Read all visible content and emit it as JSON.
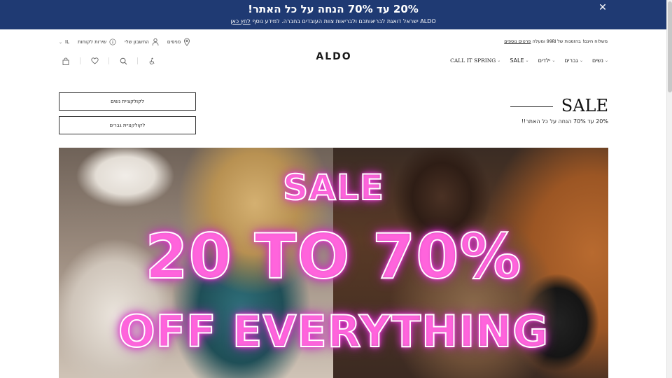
{
  "promo": {
    "title": "20% עד 70% הנחה על כל האתר!",
    "subtitle": "ALDO ישראל דואגת לבריאותכם ולבריאות צוות העובדים בחברה. למידע נוסף",
    "link_label": "לחץ כאן",
    "close_icon": "close-icon"
  },
  "utility": {
    "shipping_text": "משלוח חינם! בהזמנות של 99₪ ומעלה",
    "shipping_link": "פרטים נוספים",
    "stores_label": "סניפים",
    "account_label": "החשבון שלי",
    "service_label": "שירות לקוחות",
    "locale_label": "IL"
  },
  "logo": {
    "text": "ALDO"
  },
  "nav": {
    "items": [
      {
        "label": "נשים"
      },
      {
        "label": "גברים"
      },
      {
        "label": "ילדים"
      },
      {
        "label": "SALE"
      },
      {
        "label": "CALL IT SPRING"
      }
    ],
    "caret": "⌄"
  },
  "icons": {
    "accessibility": "accessibility-icon",
    "search": "search-icon",
    "wishlist": "heart-icon",
    "cart": "bag-icon"
  },
  "sale_header": {
    "title": "SALE",
    "subtitle": "20% עד 70% הנחה על כל האתר!!"
  },
  "buttons": {
    "women_collection": "לקולקציית נשים",
    "men_collection": "לקולקציית גברים"
  },
  "hero": {
    "line1": "SALE",
    "line2": "20 TO 70%",
    "line3": "OFF EVERYTHING",
    "accent_color": "#e23bd0"
  },
  "colors": {
    "promo_bg": "#1f3a73",
    "text": "#222222"
  }
}
